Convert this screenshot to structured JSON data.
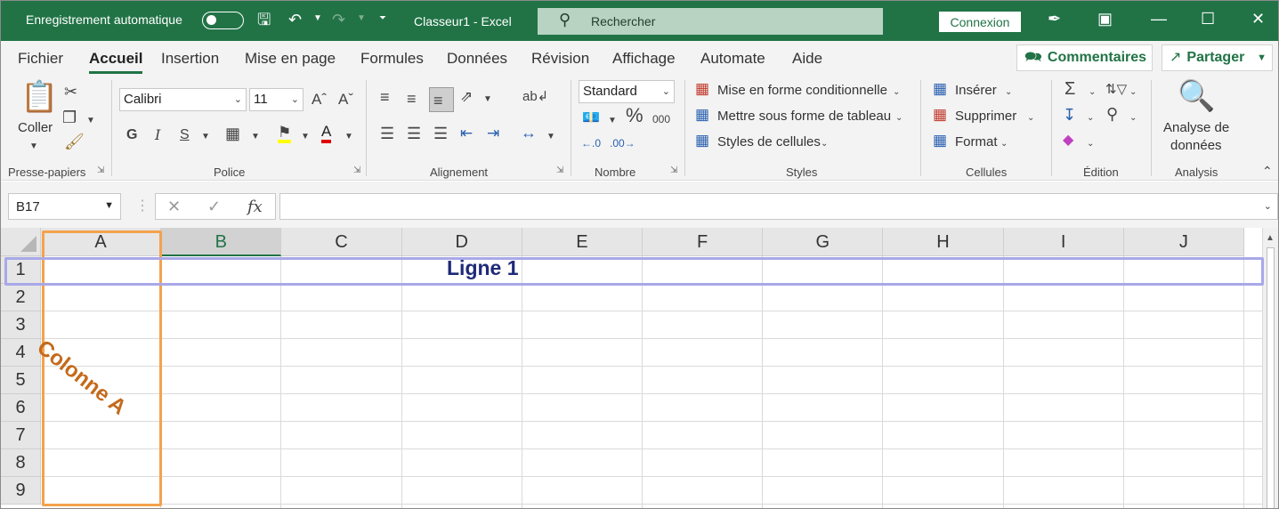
{
  "titlebar": {
    "autosave_label": "Enregistrement automatique",
    "doc_title": "Classeur1  -  Excel",
    "search_placeholder": "Rechercher",
    "login_label": "Connexion"
  },
  "tabs": [
    {
      "label": "Fichier",
      "active": false
    },
    {
      "label": "Accueil",
      "active": true
    },
    {
      "label": "Insertion",
      "active": false
    },
    {
      "label": "Mise en page",
      "active": false
    },
    {
      "label": "Formules",
      "active": false
    },
    {
      "label": "Données",
      "active": false
    },
    {
      "label": "Révision",
      "active": false
    },
    {
      "label": "Affichage",
      "active": false
    },
    {
      "label": "Automate",
      "active": false
    },
    {
      "label": "Aide",
      "active": false
    }
  ],
  "tab_actions": {
    "comments_label": "Commentaires",
    "share_label": "Partager"
  },
  "ribbon": {
    "clipboard": {
      "paste_label": "Coller",
      "group_label": "Presse-papiers"
    },
    "font": {
      "font_name": "Calibri",
      "font_size": "11",
      "group_label": "Police",
      "bold": "G",
      "italic": "I",
      "underline": "S"
    },
    "alignment": {
      "group_label": "Alignement"
    },
    "number": {
      "format": "Standard",
      "group_label": "Nombre",
      "percent": "%",
      "thousands": "000"
    },
    "styles": {
      "conditional_label": "Mise en forme conditionnelle",
      "table_label": "Mettre sous forme de tableau",
      "cell_styles_label": "Styles de cellules",
      "group_label": "Styles"
    },
    "cells": {
      "insert_label": "Insérer",
      "delete_label": "Supprimer",
      "format_label": "Format",
      "group_label": "Cellules"
    },
    "editing": {
      "group_label": "Édition"
    },
    "analysis": {
      "button_line1": "Analyse de",
      "button_line2": "données",
      "group_label": "Analysis"
    }
  },
  "formula_bar": {
    "name_box": "B17",
    "fx": "fx",
    "formula": ""
  },
  "sheet": {
    "columns": [
      "A",
      "B",
      "C",
      "D",
      "E",
      "F",
      "G",
      "H",
      "I",
      "J"
    ],
    "selected_column": "B",
    "rows": [
      "1",
      "2",
      "3",
      "4",
      "5",
      "6",
      "7",
      "8",
      "9"
    ]
  },
  "annotations": {
    "row_label": "Ligne 1",
    "column_label": "Colonne A"
  },
  "colors": {
    "brand": "#217346",
    "column_highlight": "#f4a24c",
    "row_highlight": "#a8a8e8",
    "row_label": "#1f2a78",
    "column_label": "#c46a1c"
  }
}
